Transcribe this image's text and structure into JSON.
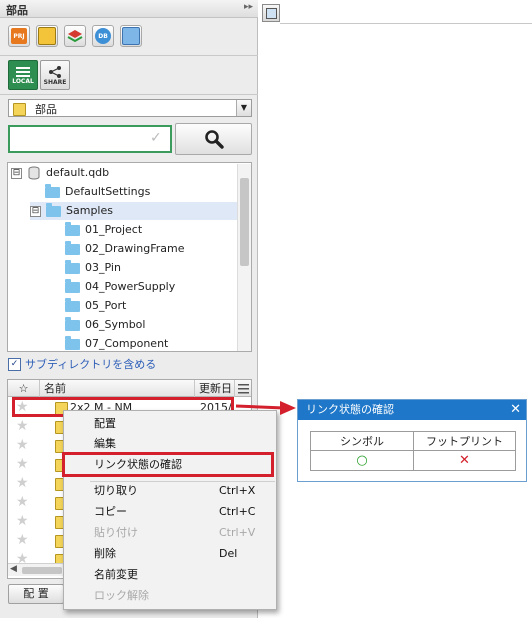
{
  "panel": {
    "title": "部品",
    "collapse_glyph": "▸▸",
    "toolbar_icons": [
      "prj-icon",
      "component-book-icon",
      "layers-icon",
      "database-icon",
      "component-library-icon"
    ],
    "prj_label": "PRJ",
    "db_label": "DB",
    "local_label": "LOCAL",
    "share_label": "SHARE",
    "combo_value": "部品",
    "combo_arrow": "▼",
    "search_placeholder": ""
  },
  "tree": {
    "root": "default.qdb",
    "items": [
      {
        "label": "DefaultSettings"
      },
      {
        "label": "Samples"
      },
      {
        "label": "01_Project"
      },
      {
        "label": "02_DrawingFrame"
      },
      {
        "label": "03_Pin"
      },
      {
        "label": "04_PowerSupply"
      },
      {
        "label": "05_Port"
      },
      {
        "label": "06_Symbol"
      },
      {
        "label": "07_Component"
      }
    ],
    "expanded_glyph": "⊟"
  },
  "subdir": {
    "label": "サブディレクトリを含める",
    "checked": true,
    "check_glyph": "✓"
  },
  "list": {
    "columns": {
      "star": "☆",
      "name": "名前",
      "date": "更新日"
    },
    "rows": [
      {
        "name": "2x2 M - NM",
        "date": "2015/"
      }
    ],
    "star_glyph": "★"
  },
  "place_button": "配 置",
  "context_menu": {
    "items": [
      {
        "label": "配置",
        "shortcut": "",
        "enabled": true
      },
      {
        "label": "編集",
        "shortcut": "",
        "enabled": true
      },
      {
        "label": "リンク状態の確認",
        "shortcut": "",
        "enabled": true
      },
      {
        "label": "切り取り",
        "shortcut": "Ctrl+X",
        "enabled": true
      },
      {
        "label": "コピー",
        "shortcut": "Ctrl+C",
        "enabled": true
      },
      {
        "label": "貼り付け",
        "shortcut": "Ctrl+V",
        "enabled": false
      },
      {
        "label": "削除",
        "shortcut": "Del",
        "enabled": true
      },
      {
        "label": "名前変更",
        "shortcut": "",
        "enabled": true
      },
      {
        "label": "ロック解除",
        "shortcut": "",
        "enabled": false
      }
    ]
  },
  "dialog": {
    "title": "リンク状態の確認",
    "close": "✕",
    "headers": [
      "シンボル",
      "フットプリント"
    ],
    "symbol_status": "○",
    "footprint_status": "✕"
  },
  "colors": {
    "accent_green": "#3a9b5c",
    "highlight_red": "#d3202c",
    "dialog_blue": "#1e77c8",
    "status_ok": "#2aa02a",
    "status_ng": "#d3202c"
  }
}
